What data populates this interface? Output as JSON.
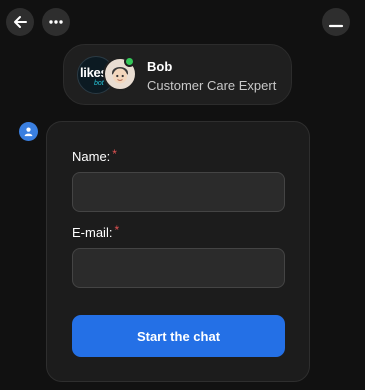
{
  "header": {
    "back_icon": "arrow-left-icon",
    "more_icon": "more-horizontal-icon",
    "minimize_icon": "minimize-icon"
  },
  "agent": {
    "logo_text": "likes",
    "logo_sub": "bot",
    "name": "Bob",
    "role": "Customer Care Expert",
    "status_color": "#34c759"
  },
  "form": {
    "name_label": "Name:",
    "email_label": "E-mail:",
    "required_mark": "*",
    "name_value": "",
    "email_value": "",
    "submit_label": "Start the chat",
    "accent_color": "#2470e6"
  }
}
